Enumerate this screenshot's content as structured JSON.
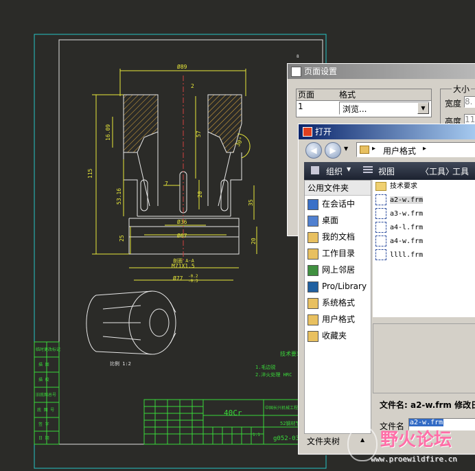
{
  "drawing": {
    "dim_top": "Ø89",
    "dim_2": "2",
    "dim_left_vert": "115",
    "dim_16": "16.09",
    "dim_57": "57",
    "dim_53": "53.16",
    "dim_7": "7",
    "dim_20": "20",
    "dim_35": "35",
    "dim_25": "25",
    "dim_20b": "20",
    "dim_36": "Ø36",
    "dim_67": "Ø67",
    "dim_section": "剖面 A-A",
    "dim_thread": "M71X1.5",
    "dim_77": "Ø77",
    "dim_77_tol_up": "-0.2",
    "dim_77_tol_lo": "-0.3",
    "angle": "30°",
    "iso_scale": "比例 1:2",
    "tech_req_title": "技术要求",
    "tech_req_1": "1.毛边锐",
    "tech_req_2": "2.淬火处理 HRC",
    "material": "40Cr",
    "company": "中国长兴机械工程公司",
    "part_no": "52钢材节",
    "drawing_no": "g052-03",
    "scale_val": "1:1",
    "ref1": "8",
    "left_labels": [
      "临时更改标记",
      "描 图",
      "描 校",
      "旧底图总号",
      "底 图 号",
      "签 字",
      "日 期"
    ]
  },
  "page_setup": {
    "title": "页面设置",
    "col_page": "页面",
    "col_format": "格式",
    "page_value": "1",
    "format_value": "浏览...",
    "size_group": "大小",
    "width_label": "宽度",
    "width_value": "8.",
    "height_label": "高度",
    "height_value": "11"
  },
  "open_dialog": {
    "title": "打开",
    "breadcrumb": "用户格式",
    "toolbar": {
      "organize": "组织",
      "views": "视图",
      "tools1": "〈工具〉",
      "tools2": "工具"
    },
    "sidebar_header": "公用文件夹",
    "sidebar_items": [
      "在会话中",
      "桌面",
      "我的文档",
      "工作目录",
      "网上邻居",
      "Pro/Library",
      "系统格式",
      "用户格式",
      "收藏夹"
    ],
    "files": [
      "技术要求",
      "a2-w.frm",
      "a3-w.frm",
      "a4-l.frm",
      "a4-w.frm",
      "llll.frm"
    ],
    "file_name_row": "文件名: a2-w.frm 修改日",
    "file_name_label": "文件名",
    "file_name_value": "a2-w.frm",
    "folder_tree": "文件夹树"
  },
  "watermark": {
    "name": "野火论坛",
    "url": "www.proewildfire.cn"
  }
}
